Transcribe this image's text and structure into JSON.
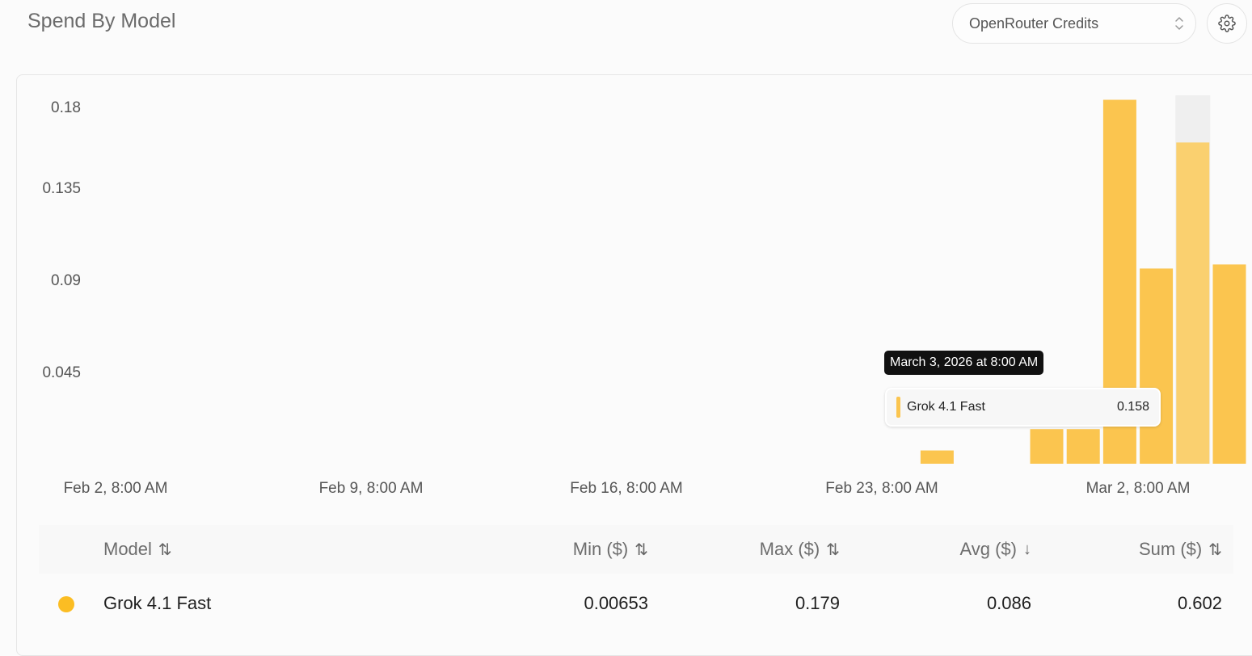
{
  "header": {
    "title": "Spend By Model",
    "select_value": "OpenRouter Credits",
    "gear_icon": "gear-icon"
  },
  "colors": {
    "bar": "#fbc54f",
    "bar_highlight": "#fad06f",
    "hover_bg": "#efefef",
    "series_dot": "#fbbd23"
  },
  "chart_data": {
    "type": "bar",
    "ylim": [
      0,
      0.18
    ],
    "yticks": [
      "0.18",
      "0.135",
      "0.09",
      "0.045"
    ],
    "xticks": [
      "Feb 2, 8:00 AM",
      "Feb 9, 8:00 AM",
      "Feb 16, 8:00 AM",
      "Feb 23, 8:00 AM",
      "Mar 2, 8:00 AM"
    ],
    "series": [
      {
        "name": "Grok 4.1 Fast",
        "points": [
          {
            "x": "2026-02-24",
            "value": 0.00653
          },
          {
            "x": "2026-02-27",
            "value": 0.017
          },
          {
            "x": "2026-02-28",
            "value": 0.017
          },
          {
            "x": "2026-03-01",
            "value": 0.179
          },
          {
            "x": "2026-03-02",
            "value": 0.096
          },
          {
            "x": "2026-03-03",
            "value": 0.158
          },
          {
            "x": "2026-03-04",
            "value": 0.098
          }
        ]
      }
    ],
    "highlighted": "2026-03-03"
  },
  "tooltip": {
    "title": "March 3, 2026 at 8:00 AM",
    "series": "Grok 4.1 Fast",
    "value": "0.158"
  },
  "table": {
    "headers": {
      "model": "Model",
      "min": "Min ($)",
      "max": "Max ($)",
      "avg": "Avg ($)",
      "sum": "Sum ($)"
    },
    "sort_icons": {
      "model": "⇅",
      "min": "⇅",
      "max": "⇅",
      "avg": "↓",
      "sum": "⇅"
    },
    "rows": [
      {
        "model": "Grok 4.1 Fast",
        "min": "0.00653",
        "max": "0.179",
        "avg": "0.086",
        "sum": "0.602"
      }
    ]
  }
}
